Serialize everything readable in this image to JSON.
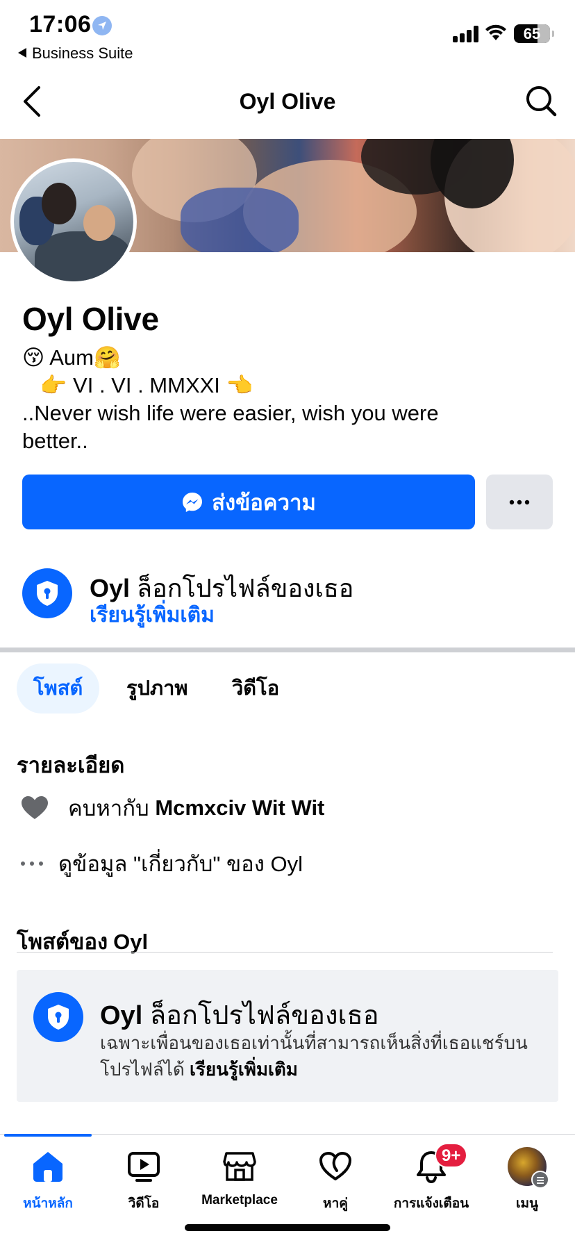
{
  "status_bar": {
    "time": "17:06",
    "back_app": "Business Suite",
    "battery": "65"
  },
  "header": {
    "title": "Oyl Olive"
  },
  "profile": {
    "name": "Oyl Olive",
    "bio_lines": [
      "😚 Aum🤗",
      "   👉 VI . VI . MMXXI 👈",
      "..Never wish life were easier, wish you were",
      "better.."
    ]
  },
  "actions": {
    "message_label": "ส่งข้อความ",
    "more_label": "···"
  },
  "lock_notice": {
    "name": "Oyl",
    "text": "ล็อกโปรไฟล์ของเธอ",
    "link": "เรียนรู้เพิ่มเติม"
  },
  "tabs": [
    {
      "label": "โพสต์",
      "active": true
    },
    {
      "label": "รูปภาพ",
      "active": false
    },
    {
      "label": "วิดีโอ",
      "active": false
    }
  ],
  "details": {
    "title": "รายละเอียด",
    "relationship_prefix": "คบหากับ",
    "relationship_name": "Mcmxciv Wit Wit",
    "about_text": "ดูข้อมูล \"เกี่ยวกับ\" ของ Oyl"
  },
  "posts": {
    "title_prefix": "โพสต์ของ",
    "title_name": "Oyl",
    "card_name": "Oyl",
    "card_title": "ล็อกโปรไฟล์ของเธอ",
    "card_desc": "เฉพาะเพื่อนของเธอเท่านั้นที่สามารถเห็นสิ่งที่เธอแชร์บนโปรไฟล์ได้",
    "card_link": "เรียนรู้เพิ่มเติม"
  },
  "bottom_nav": {
    "items": [
      {
        "label": "หน้าหลัก",
        "icon": "home-icon",
        "active": true
      },
      {
        "label": "วิดีโอ",
        "icon": "video-icon",
        "active": false
      },
      {
        "label": "Marketplace",
        "icon": "marketplace-icon",
        "active": false
      },
      {
        "label": "หาคู่",
        "icon": "dating-heart-icon",
        "active": false
      },
      {
        "label": "การแจ้งเตือน",
        "icon": "bell-icon",
        "active": false,
        "badge": "9+"
      },
      {
        "label": "เมนู",
        "icon": "menu-avatar",
        "active": false
      }
    ]
  },
  "colors": {
    "accent": "#0866ff",
    "badge": "#e41e3f",
    "secondary_button": "#e4e6eb"
  }
}
